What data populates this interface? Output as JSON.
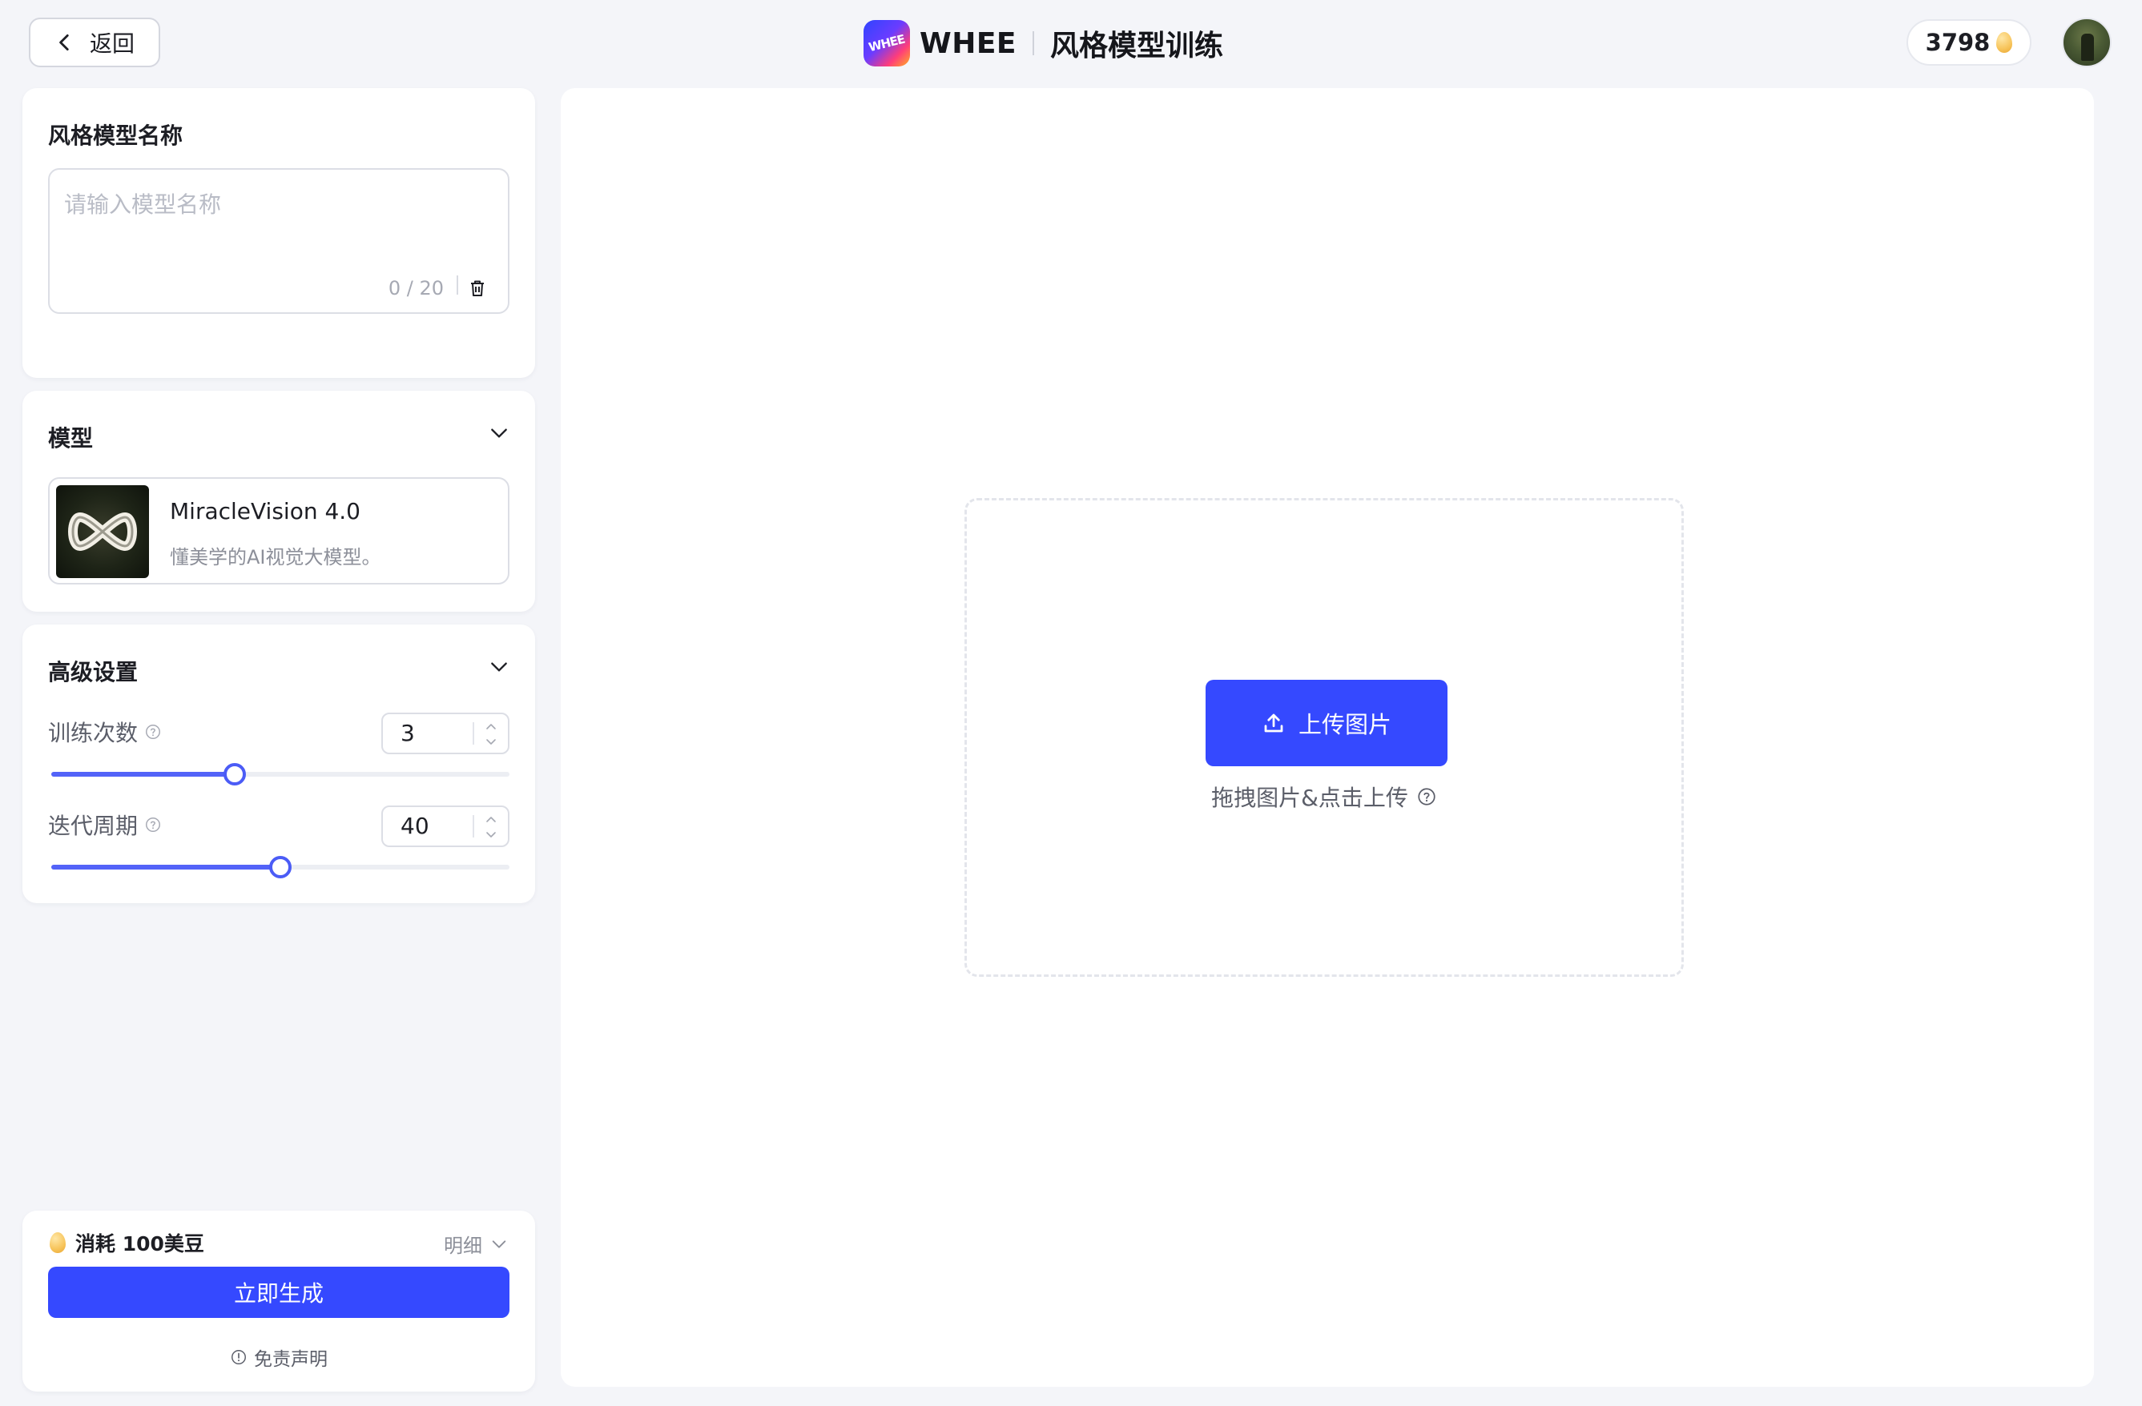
{
  "header": {
    "back_label": "返回",
    "brand_logo_text": "WHEE",
    "brand_name": "WHEE",
    "page_title": "风格模型训练",
    "credits": "3798"
  },
  "name_section": {
    "title": "风格模型名称",
    "placeholder": "请输入模型名称",
    "counter": "0 / 20"
  },
  "model_section": {
    "title": "模型",
    "model_name": "MiracleVision 4.0",
    "model_desc": "懂美学的AI视觉大模型。"
  },
  "advanced_section": {
    "title": "高级设置",
    "settings": [
      {
        "label": "训练次数",
        "value": "3",
        "fill_fraction": 0.4
      },
      {
        "label": "迭代周期",
        "value": "40",
        "fill_fraction": 0.5
      }
    ]
  },
  "footer": {
    "cost_label": "消耗 100美豆",
    "detail_label": "明细",
    "generate_label": "立即生成",
    "disclaimer_label": "免责声明"
  },
  "upload": {
    "button_label": "上传图片",
    "hint": "拖拽图片&点击上传"
  },
  "colors": {
    "accent": "#3549ff",
    "slider": "#5363f8",
    "page_bg": "#f4f5f9"
  },
  "icons": [
    "chevron-left-icon",
    "trash-icon",
    "chevron-down-icon",
    "help-icon",
    "stepper-icon",
    "bean-icon",
    "info-icon",
    "upload-icon"
  ]
}
